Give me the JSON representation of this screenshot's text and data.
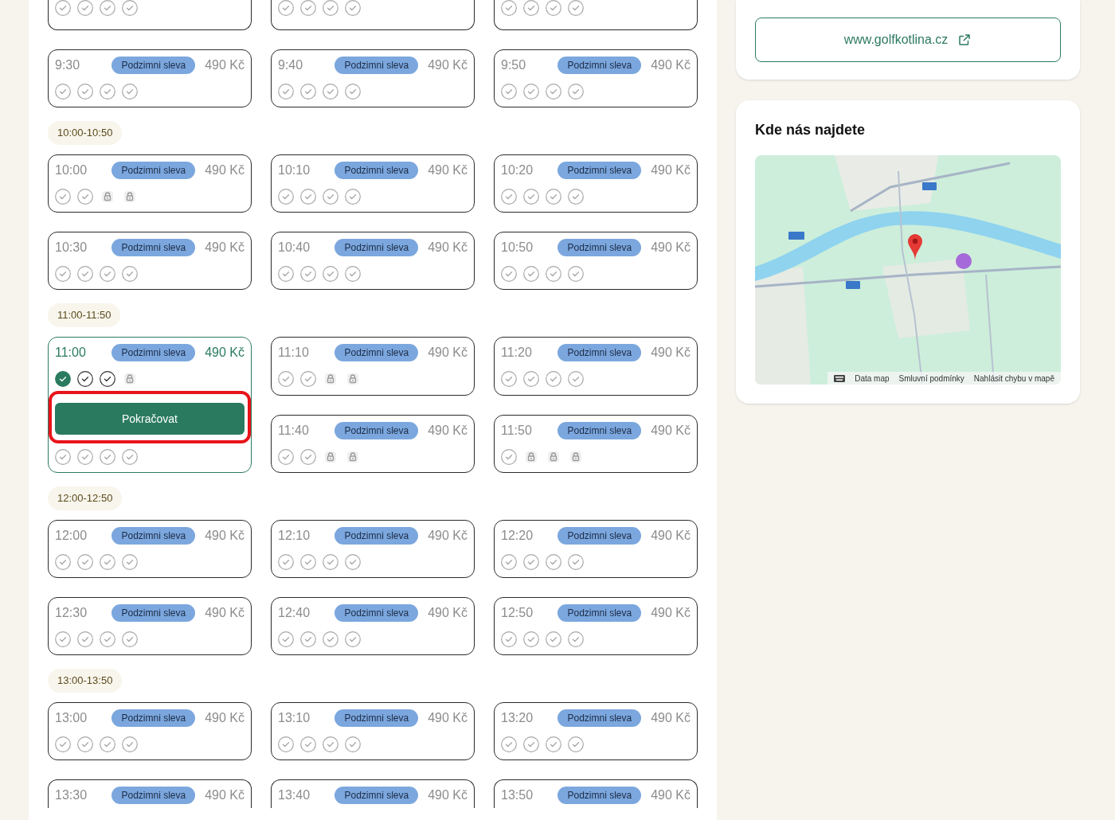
{
  "sections": [
    {
      "slots": [
        {
          "seats": [
            {
              "kind": "free",
              "selected": false
            },
            {
              "kind": "free",
              "selected": false
            },
            {
              "kind": "free",
              "selected": false
            },
            {
              "kind": "free",
              "selected": false
            }
          ]
        },
        {
          "seats": [
            {
              "kind": "free",
              "selected": false
            },
            {
              "kind": "free",
              "selected": false
            },
            {
              "kind": "free",
              "selected": false
            },
            {
              "kind": "free",
              "selected": false
            }
          ]
        },
        {
          "seats": [
            {
              "kind": "free",
              "selected": false
            },
            {
              "kind": "free",
              "selected": false
            },
            {
              "kind": "free",
              "selected": false
            },
            {
              "kind": "free",
              "selected": false
            }
          ]
        },
        {
          "time": "9:30",
          "badge": "Podzimni sleva",
          "price": "490 Kč",
          "selected": false,
          "seats": [
            {
              "kind": "free",
              "selected": false
            },
            {
              "kind": "free",
              "selected": false
            },
            {
              "kind": "free",
              "selected": false
            },
            {
              "kind": "free",
              "selected": false
            }
          ]
        },
        {
          "time": "9:40",
          "badge": "Podzimni sleva",
          "price": "490 Kč",
          "selected": false,
          "seats": [
            {
              "kind": "free",
              "selected": false
            },
            {
              "kind": "free",
              "selected": false
            },
            {
              "kind": "free",
              "selected": false
            },
            {
              "kind": "free",
              "selected": false
            }
          ]
        },
        {
          "time": "9:50",
          "badge": "Podzimni sleva",
          "price": "490 Kč",
          "selected": false,
          "seats": [
            {
              "kind": "free",
              "selected": false
            },
            {
              "kind": "free",
              "selected": false
            },
            {
              "kind": "free",
              "selected": false
            },
            {
              "kind": "free",
              "selected": false
            }
          ]
        }
      ]
    },
    {
      "label": "10:00-10:50",
      "slots": [
        {
          "time": "10:00",
          "badge": "Podzimni sleva",
          "price": "490 Kč",
          "selected": false,
          "seats": [
            {
              "kind": "free",
              "selected": false
            },
            {
              "kind": "free",
              "selected": false
            },
            {
              "kind": "locked",
              "selected": false
            },
            {
              "kind": "locked",
              "selected": false
            }
          ]
        },
        {
          "time": "10:10",
          "badge": "Podzimni sleva",
          "price": "490 Kč",
          "selected": false,
          "seats": [
            {
              "kind": "free",
              "selected": false
            },
            {
              "kind": "free",
              "selected": false
            },
            {
              "kind": "free",
              "selected": false
            },
            {
              "kind": "free",
              "selected": false
            }
          ]
        },
        {
          "time": "10:20",
          "badge": "Podzimni sleva",
          "price": "490 Kč",
          "selected": false,
          "seats": [
            {
              "kind": "free",
              "selected": false
            },
            {
              "kind": "free",
              "selected": false
            },
            {
              "kind": "free",
              "selected": false
            },
            {
              "kind": "free",
              "selected": false
            }
          ]
        },
        {
          "time": "10:30",
          "badge": "Podzimni sleva",
          "price": "490 Kč",
          "selected": false,
          "seats": [
            {
              "kind": "free",
              "selected": false
            },
            {
              "kind": "free",
              "selected": false
            },
            {
              "kind": "free",
              "selected": false
            },
            {
              "kind": "free",
              "selected": false
            }
          ]
        },
        {
          "time": "10:40",
          "badge": "Podzimni sleva",
          "price": "490 Kč",
          "selected": false,
          "seats": [
            {
              "kind": "free",
              "selected": false
            },
            {
              "kind": "free",
              "selected": false
            },
            {
              "kind": "free",
              "selected": false
            },
            {
              "kind": "free",
              "selected": false
            }
          ]
        },
        {
          "time": "10:50",
          "badge": "Podzimni sleva",
          "price": "490 Kč",
          "selected": false,
          "seats": [
            {
              "kind": "free",
              "selected": false
            },
            {
              "kind": "free",
              "selected": false
            },
            {
              "kind": "free",
              "selected": false
            },
            {
              "kind": "free",
              "selected": false
            }
          ]
        }
      ]
    },
    {
      "label": "11:00-11:50",
      "slots": [
        {
          "time": "11:00",
          "badge": "Podzimni sleva",
          "price": "490 Kč",
          "selected": true,
          "seats": [
            {
              "kind": "free",
              "selected": true
            },
            {
              "kind": "free",
              "selected": false
            },
            {
              "kind": "free",
              "selected": false
            },
            {
              "kind": "locked",
              "selected": false
            }
          ],
          "button": {
            "label": "Pokračovat",
            "highlighted": true
          },
          "extra_seats": [
            {
              "kind": "free",
              "selected": false
            },
            {
              "kind": "free",
              "selected": false
            },
            {
              "kind": "free",
              "selected": false
            },
            {
              "kind": "free",
              "selected": false
            }
          ]
        },
        {
          "time": "11:10",
          "badge": "Podzimni sleva",
          "price": "490 Kč",
          "selected": false,
          "seats": [
            {
              "kind": "free",
              "selected": false
            },
            {
              "kind": "free",
              "selected": false
            },
            {
              "kind": "locked",
              "selected": false
            },
            {
              "kind": "locked",
              "selected": false
            }
          ]
        },
        {
          "time": "11:20",
          "badge": "Podzimni sleva",
          "price": "490 Kč",
          "selected": false,
          "seats": [
            {
              "kind": "free",
              "selected": false
            },
            {
              "kind": "free",
              "selected": false
            },
            {
              "kind": "free",
              "selected": false
            },
            {
              "kind": "free",
              "selected": false
            }
          ]
        },
        {
          "time": "11:40",
          "badge": "Podzimni sleva",
          "price": "490 Kč",
          "selected": false,
          "seats": [
            {
              "kind": "free",
              "selected": false
            },
            {
              "kind": "free",
              "selected": false
            },
            {
              "kind": "locked",
              "selected": false
            },
            {
              "kind": "locked",
              "selected": false
            }
          ]
        },
        {
          "time": "11:50",
          "badge": "Podzimni sleva",
          "price": "490 Kč",
          "selected": false,
          "seats": [
            {
              "kind": "free",
              "selected": false
            },
            {
              "kind": "locked",
              "selected": false
            },
            {
              "kind": "locked",
              "selected": false
            },
            {
              "kind": "locked",
              "selected": false
            }
          ]
        }
      ]
    },
    {
      "label": "12:00-12:50",
      "slots": [
        {
          "time": "12:00",
          "badge": "Podzimni sleva",
          "price": "490 Kč",
          "selected": false,
          "seats": [
            {
              "kind": "free",
              "selected": false
            },
            {
              "kind": "free",
              "selected": false
            },
            {
              "kind": "free",
              "selected": false
            },
            {
              "kind": "free",
              "selected": false
            }
          ]
        },
        {
          "time": "12:10",
          "badge": "Podzimni sleva",
          "price": "490 Kč",
          "selected": false,
          "seats": [
            {
              "kind": "free",
              "selected": false
            },
            {
              "kind": "free",
              "selected": false
            },
            {
              "kind": "free",
              "selected": false
            },
            {
              "kind": "free",
              "selected": false
            }
          ]
        },
        {
          "time": "12:20",
          "badge": "Podzimni sleva",
          "price": "490 Kč",
          "selected": false,
          "seats": [
            {
              "kind": "free",
              "selected": false
            },
            {
              "kind": "free",
              "selected": false
            },
            {
              "kind": "free",
              "selected": false
            },
            {
              "kind": "free",
              "selected": false
            }
          ]
        },
        {
          "time": "12:30",
          "badge": "Podzimni sleva",
          "price": "490 Kč",
          "selected": false,
          "seats": [
            {
              "kind": "free",
              "selected": false
            },
            {
              "kind": "free",
              "selected": false
            },
            {
              "kind": "free",
              "selected": false
            },
            {
              "kind": "free",
              "selected": false
            }
          ]
        },
        {
          "time": "12:40",
          "badge": "Podzimni sleva",
          "price": "490 Kč",
          "selected": false,
          "seats": [
            {
              "kind": "free",
              "selected": false
            },
            {
              "kind": "free",
              "selected": false
            },
            {
              "kind": "free",
              "selected": false
            },
            {
              "kind": "free",
              "selected": false
            }
          ]
        },
        {
          "time": "12:50",
          "badge": "Podzimni sleva",
          "price": "490 Kč",
          "selected": false,
          "seats": [
            {
              "kind": "free",
              "selected": false
            },
            {
              "kind": "free",
              "selected": false
            },
            {
              "kind": "free",
              "selected": false
            },
            {
              "kind": "free",
              "selected": false
            }
          ]
        }
      ]
    },
    {
      "label": "13:00-13:50",
      "slots": [
        {
          "time": "13:00",
          "badge": "Podzimni sleva",
          "price": "490 Kč",
          "selected": false,
          "seats": [
            {
              "kind": "free",
              "selected": false
            },
            {
              "kind": "free",
              "selected": false
            },
            {
              "kind": "free",
              "selected": false
            },
            {
              "kind": "free",
              "selected": false
            }
          ]
        },
        {
          "time": "13:10",
          "badge": "Podzimni sleva",
          "price": "490 Kč",
          "selected": false,
          "seats": [
            {
              "kind": "free",
              "selected": false
            },
            {
              "kind": "free",
              "selected": false
            },
            {
              "kind": "free",
              "selected": false
            },
            {
              "kind": "free",
              "selected": false
            }
          ]
        },
        {
          "time": "13:20",
          "badge": "Podzimni sleva",
          "price": "490 Kč",
          "selected": false,
          "seats": [
            {
              "kind": "free",
              "selected": false
            },
            {
              "kind": "free",
              "selected": false
            },
            {
              "kind": "free",
              "selected": false
            },
            {
              "kind": "free",
              "selected": false
            }
          ]
        },
        {
          "time": "13:30",
          "badge": "Podzimni sleva",
          "price": "490 Kč",
          "selected": false
        },
        {
          "time": "13:40",
          "badge": "Podzimni sleva",
          "price": "490 Kč",
          "selected": false
        },
        {
          "time": "13:50",
          "badge": "Podzimni sleva",
          "price": "490 Kč",
          "selected": false
        }
      ]
    }
  ],
  "website": {
    "label": "www.golfkotlina.cz"
  },
  "location": {
    "title": "Kde nás najdete",
    "map": {
      "kind": "picture",
      "links": [
        "Data map",
        "Smluvní podmínky",
        "Nahlásit chybu v mapě"
      ]
    }
  }
}
